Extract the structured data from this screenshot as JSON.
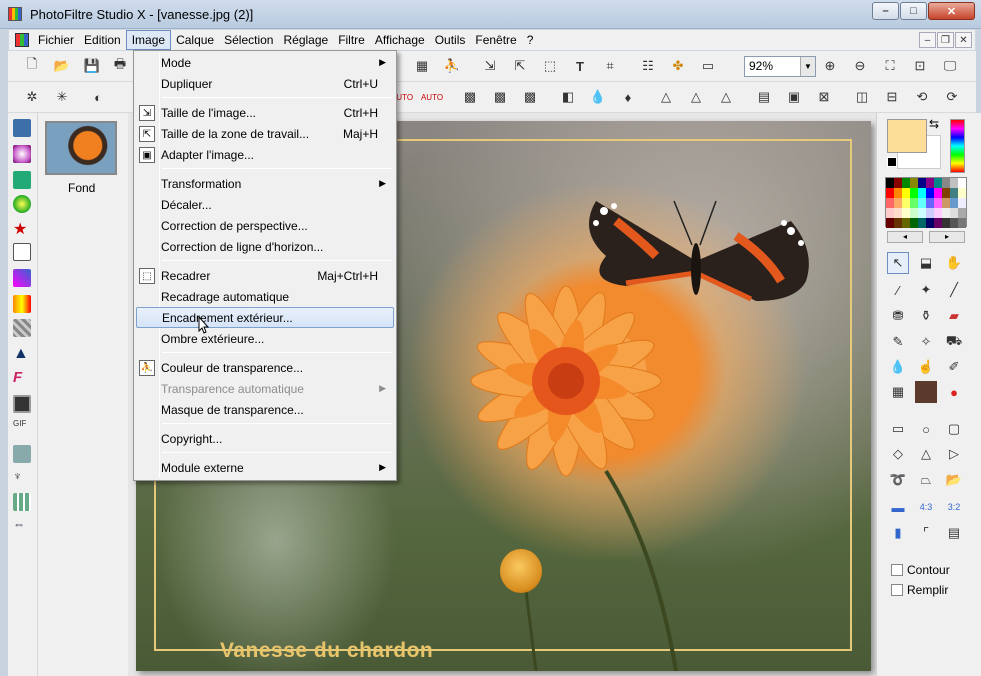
{
  "window": {
    "title": "PhotoFiltre Studio X - [vanesse.jpg (2)]",
    "min": "–",
    "max": "□",
    "close": "✕"
  },
  "menubar": {
    "items": [
      "Fichier",
      "Edition",
      "Image",
      "Calque",
      "Sélection",
      "Réglage",
      "Filtre",
      "Affichage",
      "Outils",
      "Fenêtre",
      "?"
    ],
    "active": "Image"
  },
  "toolbar": {
    "zoom": "92%"
  },
  "layers": {
    "items": [
      {
        "label": "Fond"
      }
    ]
  },
  "image_menu": {
    "items": [
      {
        "label": "Mode",
        "submenu": true
      },
      {
        "label": "Dupliquer",
        "shortcut": "Ctrl+U"
      },
      {
        "label": "Taille de l'image...",
        "shortcut": "Ctrl+H",
        "icon": "resize-icon"
      },
      {
        "label": "Taille de la zone de travail...",
        "shortcut": "Maj+H",
        "icon": "canvas-size-icon"
      },
      {
        "label": "Adapter l'image...",
        "icon": "fit-image-icon"
      },
      {
        "label": "Transformation",
        "submenu": true
      },
      {
        "label": "Décaler..."
      },
      {
        "label": "Correction de perspective..."
      },
      {
        "label": "Correction de ligne d'horizon..."
      },
      {
        "label": "Recadrer",
        "shortcut": "Maj+Ctrl+H",
        "icon": "crop-icon"
      },
      {
        "label": "Recadrage automatique"
      },
      {
        "label": "Encadrement extérieur...",
        "highlighted": true
      },
      {
        "label": "Ombre extérieure..."
      },
      {
        "label": "Couleur de transparence...",
        "icon": "transparency-color-icon"
      },
      {
        "label": "Transparence automatique",
        "submenu": true,
        "disabled": true
      },
      {
        "label": "Masque de transparence..."
      },
      {
        "label": "Copyright..."
      },
      {
        "label": "Module externe",
        "submenu": true
      }
    ]
  },
  "canvas": {
    "caption": "Vanesse du chardon"
  },
  "right_panel": {
    "contour_label": "Contour",
    "fill_label": "Remplir",
    "contour_checked": false,
    "fill_checked": false,
    "fg_color": "#fdde98"
  }
}
